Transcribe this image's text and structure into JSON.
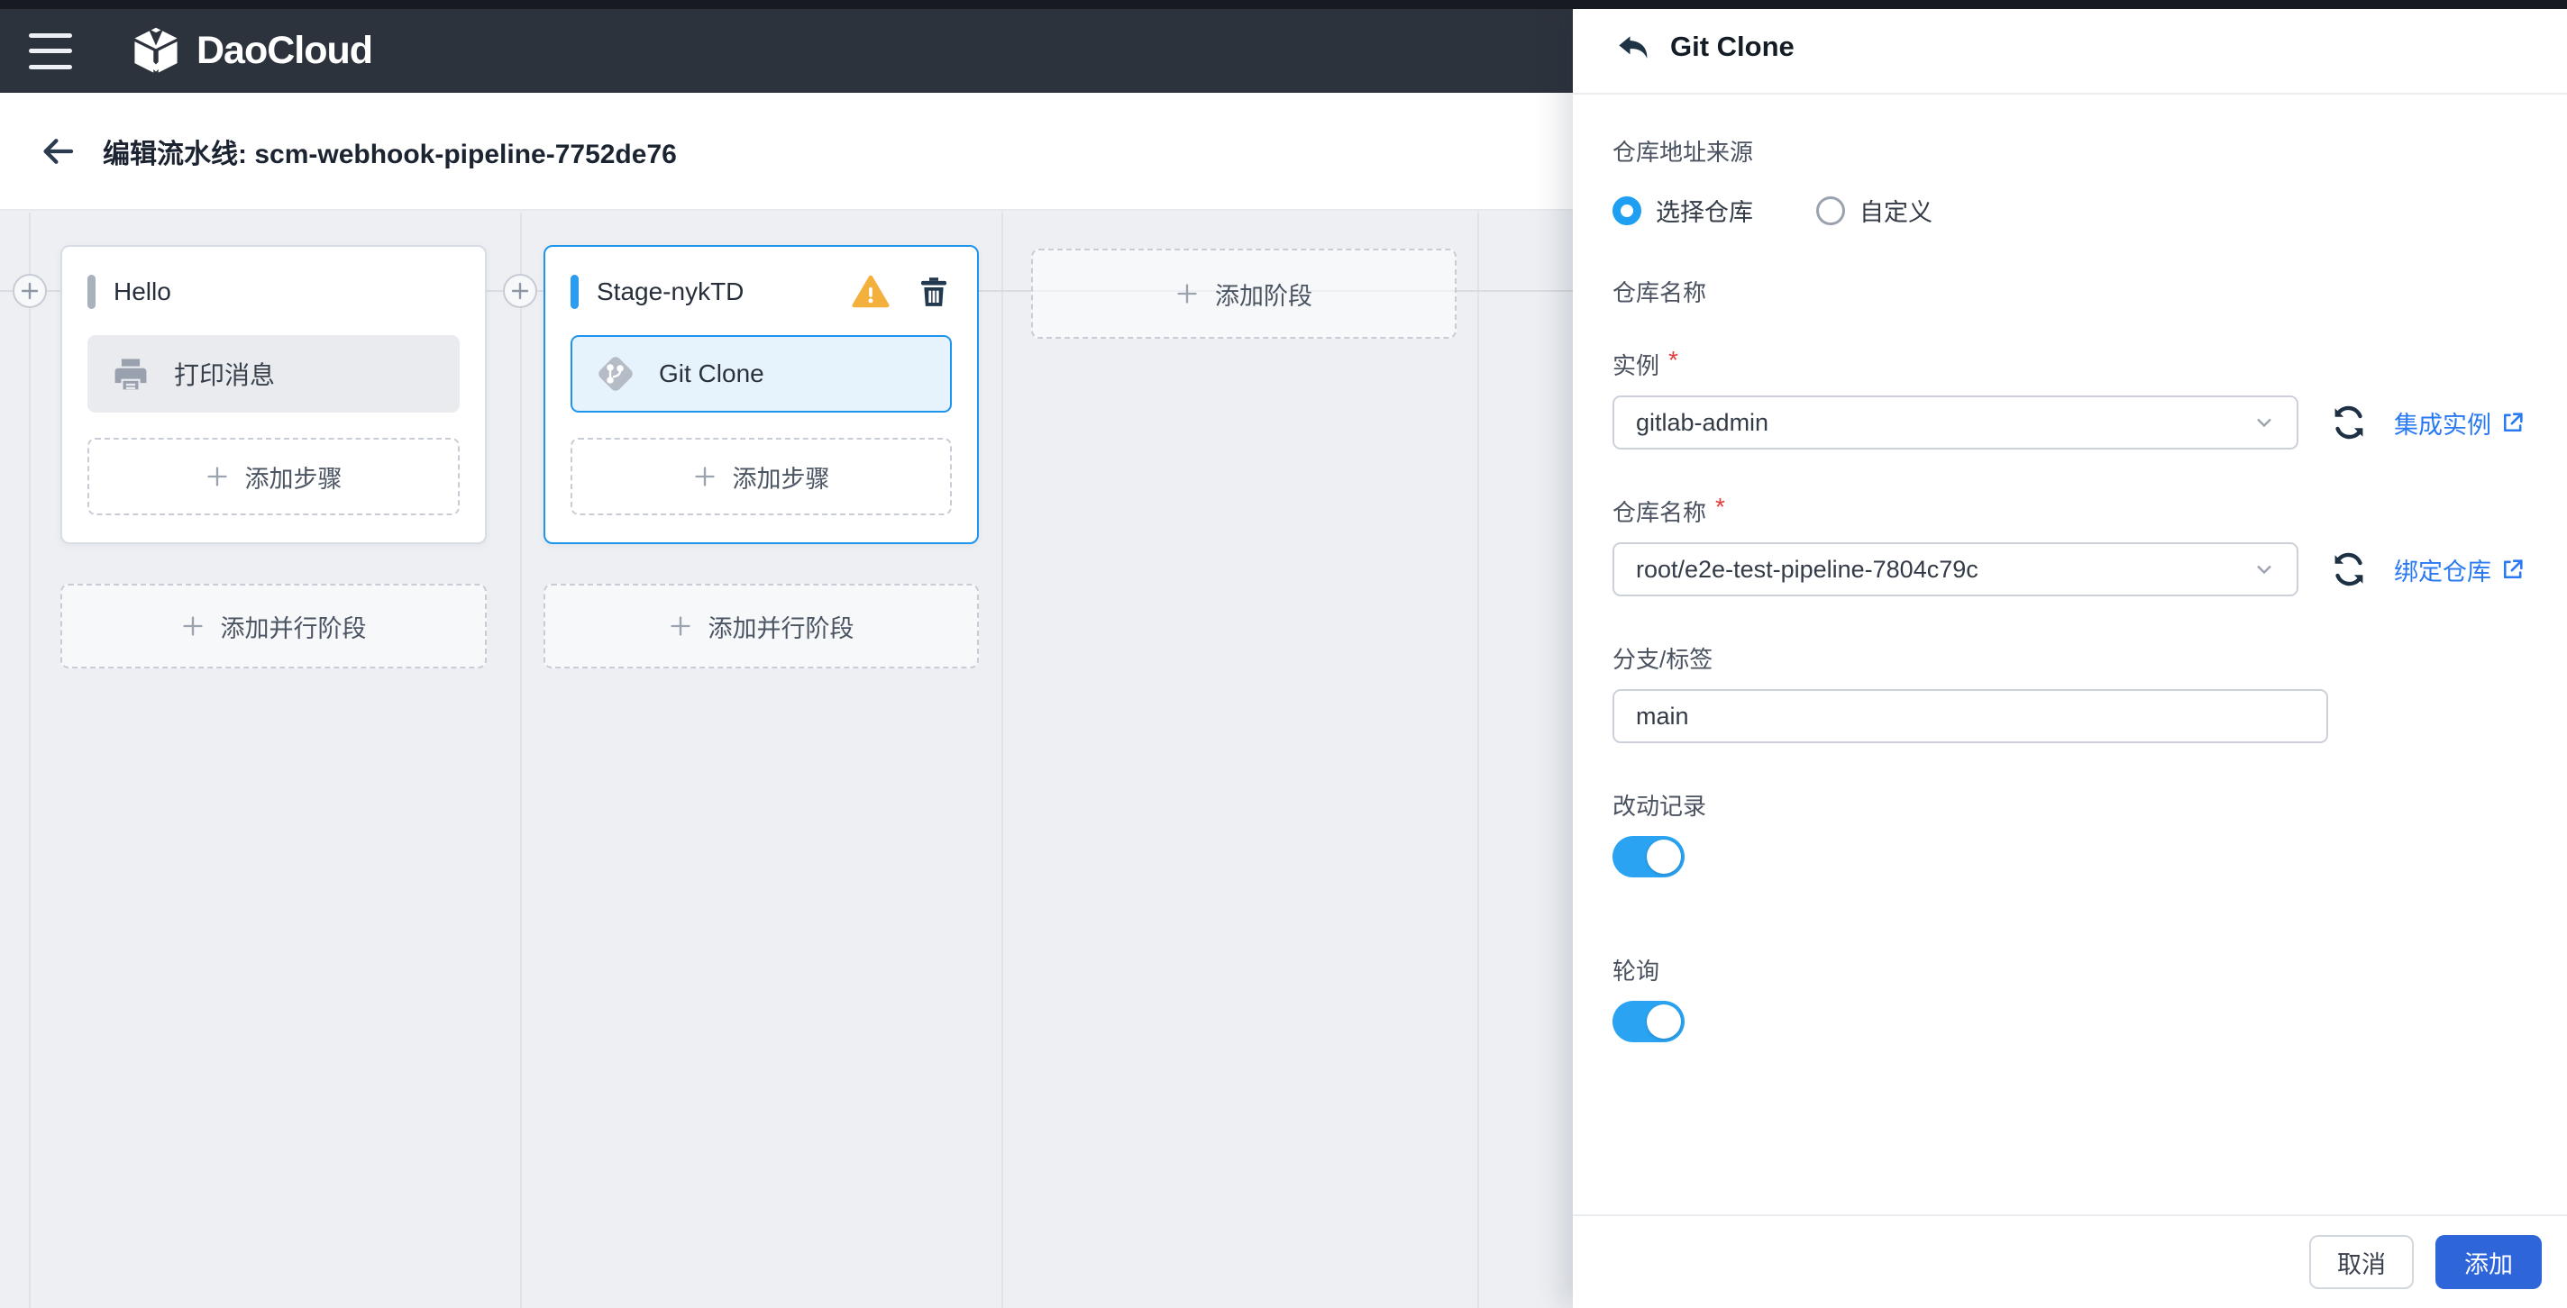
{
  "topbar": {
    "menu_icon": "hamburger-icon",
    "brand_icon": "daocloud-cube-icon",
    "brand": "DaoCloud"
  },
  "breadcrumb": {
    "back_icon": "arrow-left-icon",
    "title": "编辑流水线: scm-webhook-pipeline-7752de76"
  },
  "canvas": {
    "stages": [
      {
        "name": "Hello",
        "selected": false,
        "steps": [
          {
            "icon": "printer-icon",
            "label": "打印消息",
            "selected": false
          }
        ],
        "add_step": "添加步骤",
        "add_parallel": "添加并行阶段"
      },
      {
        "name": "Stage-nykTD",
        "selected": true,
        "warning_icon": "warning-icon",
        "delete_icon": "trash-icon",
        "steps": [
          {
            "icon": "git-icon",
            "label": "Git Clone",
            "selected": true
          }
        ],
        "add_step": "添加步骤",
        "add_parallel": "添加并行阶段"
      }
    ],
    "add_stage": "添加阶段",
    "connector_icon": "plus-node-icon"
  },
  "panel": {
    "icon": "reply-arrow-icon",
    "title": "Git Clone",
    "repo_source": {
      "label": "仓库地址来源",
      "options": [
        {
          "label": "选择仓库",
          "selected": true
        },
        {
          "label": "自定义",
          "selected": false
        }
      ]
    },
    "section": {
      "label": "仓库名称"
    },
    "instance": {
      "label": "实例",
      "required": "*",
      "value": "gitlab-admin",
      "refresh_icon": "refresh-icon",
      "link": "集成实例",
      "link_icon": "external-link-icon"
    },
    "repo": {
      "label": "仓库名称",
      "required": "*",
      "value": "root/e2e-test-pipeline-7804c79c",
      "refresh_icon": "refresh-icon",
      "link": "绑定仓库",
      "link_icon": "external-link-icon"
    },
    "branch": {
      "label": "分支/标签",
      "value": "main"
    },
    "changelog": {
      "label": "改动记录",
      "on": true
    },
    "polling": {
      "label": "轮询",
      "on": true
    },
    "footer": {
      "cancel": "取消",
      "submit": "添加"
    }
  },
  "colors": {
    "topbar_bg": "#2d333c",
    "canvas_bg": "#edeff3",
    "accent_blue": "#1f9ff2",
    "selected_border": "#1e95ed",
    "primary_button": "#2e65d9",
    "link_blue": "#2979f2",
    "warning": "#f3b03c",
    "danger_asterisk": "#e23d3a"
  }
}
